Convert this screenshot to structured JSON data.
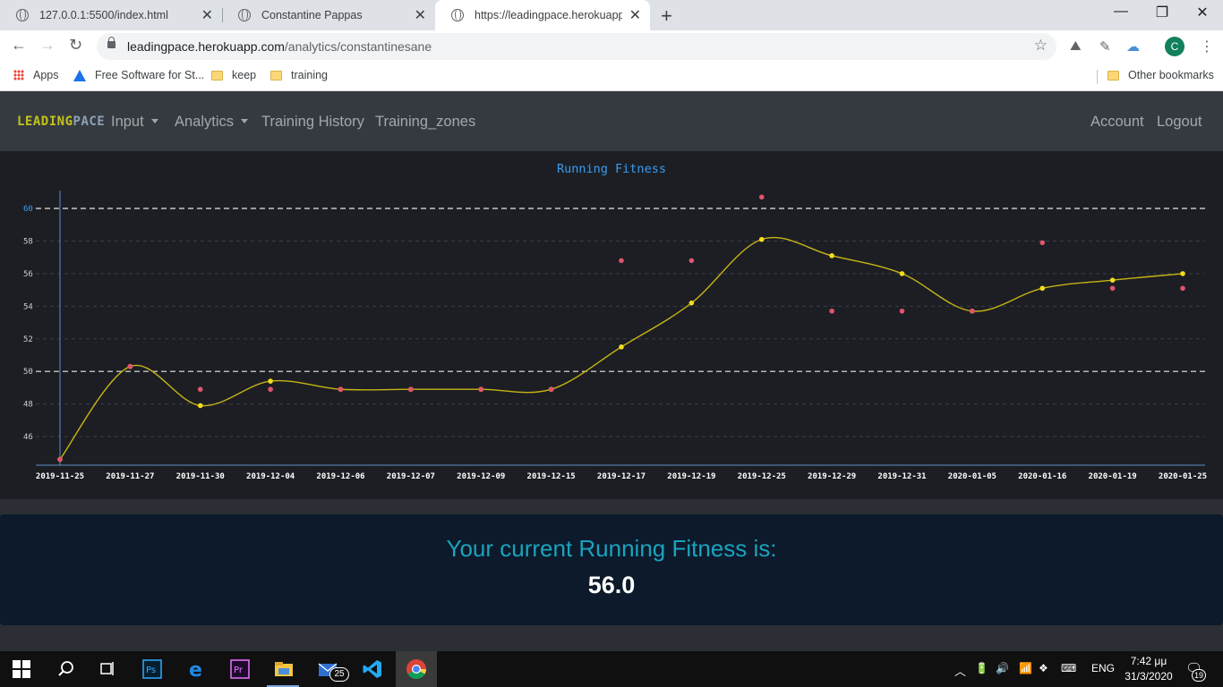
{
  "browser": {
    "tabs": [
      {
        "title": "127.0.0.1:5500/index.html",
        "active": false
      },
      {
        "title": "Constantine Pappas",
        "active": false
      },
      {
        "title": "https://leadingpace.herokuapp.co",
        "active": true
      }
    ],
    "new_tab": "+",
    "window_controls": {
      "minimize": "—",
      "restore": "❐",
      "close": "✕"
    },
    "url_host": "leadingpace.herokuapp.com",
    "url_path": "/analytics/constantinesane",
    "profile_initial": "C",
    "bookmarks": [
      {
        "label": "Apps",
        "icon": "apps-grid-icon"
      },
      {
        "label": "Free Software for St...",
        "icon": "autodesk-icon"
      },
      {
        "label": "keep",
        "icon": "folder-icon"
      },
      {
        "label": "training",
        "icon": "folder-icon"
      }
    ],
    "other_bookmarks": "Other bookmarks"
  },
  "app": {
    "brand_part1": "LEADING",
    "brand_part2": "PACE",
    "nav": {
      "input": "Input",
      "analytics": "Analytics",
      "history": "Training History",
      "zones": "Training_zones",
      "account": "Account",
      "logout": "Logout"
    },
    "fitness_label": "Your current Running Fitness is:",
    "fitness_value": "56.0"
  },
  "chart_data": {
    "type": "line",
    "title": "Running Fitness",
    "categories": [
      "2019-11-25",
      "2019-11-27",
      "2019-11-30",
      "2019-12-04",
      "2019-12-06",
      "2019-12-07",
      "2019-12-09",
      "2019-12-15",
      "2019-12-17",
      "2019-12-19",
      "2019-12-25",
      "2019-12-29",
      "2019-12-31",
      "2020-01-05",
      "2020-01-16",
      "2020-01-19",
      "2020-01-25"
    ],
    "series": [
      {
        "values": [
          44.6,
          50.3,
          47.9,
          49.4,
          48.9,
          48.9,
          48.9,
          48.9,
          51.5,
          54.2,
          58.1,
          57.1,
          56.0,
          53.7,
          55.1,
          55.6,
          56.0
        ],
        "color": "#c6b416",
        "marker": "#f2dd1d"
      },
      {
        "values": [
          44.6,
          50.3,
          48.9,
          48.9,
          48.9,
          48.9,
          48.9,
          48.9,
          56.8,
          56.8,
          60.7,
          53.7,
          53.7,
          53.7,
          57.9,
          55.1,
          55.1
        ],
        "color": "#e0546c",
        "marker": "#e0546c"
      }
    ],
    "yticks": [
      46,
      48,
      50,
      52,
      54,
      56,
      58,
      60
    ],
    "ylim": [
      44.3,
      61.1
    ],
    "reference_lines": [
      50,
      60
    ],
    "grid": true,
    "colors": {
      "background": "#1c1e23",
      "axis": "#5b8fc7",
      "title": "#3b9cf5"
    }
  },
  "taskbar": {
    "apps": [
      "start-icon",
      "search-icon",
      "task-view-icon",
      "photoshop-icon",
      "edge-icon",
      "premiere-icon",
      "file-explorer-icon",
      "mail-icon",
      "vscode-icon",
      "chrome-icon"
    ],
    "mail_badge": "25",
    "language": "ENG",
    "time": "7:42 μμ",
    "date": "31/3/2020",
    "notifications": "19"
  }
}
